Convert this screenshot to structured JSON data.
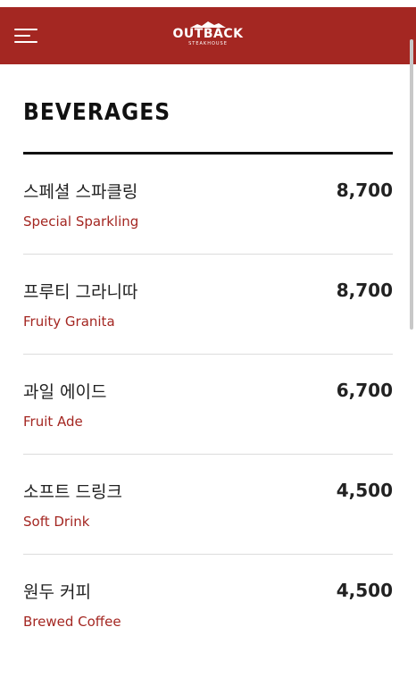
{
  "header": {
    "logo_text": "OUTBACK",
    "logo_subtext": "STEAKHOUSE",
    "brand_color": "#a42722",
    "menu_icon": "hamburger-icon"
  },
  "section": {
    "title": "BEVERAGES"
  },
  "items": [
    {
      "name_ko": "스페셜 스파클링",
      "name_en": "Special Sparkling",
      "price": "8,700"
    },
    {
      "name_ko": "프루티 그라니따",
      "name_en": "Fruity Granita",
      "price": "8,700"
    },
    {
      "name_ko": "과일 에이드",
      "name_en": "Fruit Ade",
      "price": "6,700"
    },
    {
      "name_ko": "소프트 드링크",
      "name_en": "Soft Drink",
      "price": "4,500"
    },
    {
      "name_ko": "원두 커피",
      "name_en": "Brewed Coffee",
      "price": "4,500"
    }
  ]
}
